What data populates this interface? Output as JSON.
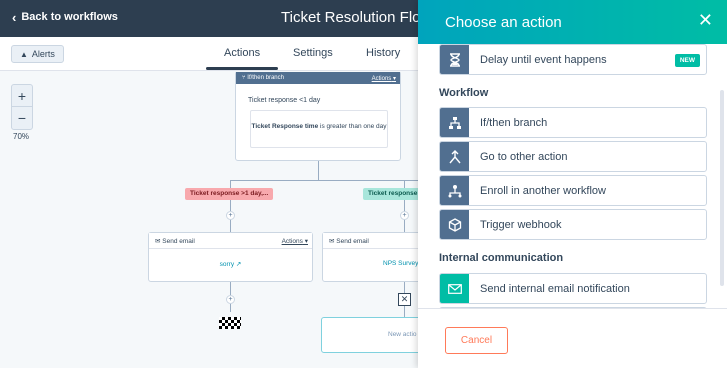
{
  "header": {
    "back_label": "Back to workflows",
    "workflow_title": "Ticket Resolution Flow"
  },
  "tabbar": {
    "alerts_label": "Alerts",
    "tabs": [
      {
        "label": "Actions",
        "active": true
      },
      {
        "label": "Settings",
        "active": false
      },
      {
        "label": "History",
        "active": false
      }
    ]
  },
  "canvas": {
    "zoom_in": "+",
    "zoom_out": "−",
    "zoom_level": "70%",
    "branch_node": {
      "header": "If/then branch",
      "actions_label": "Actions",
      "title": "Ticket response <1 day",
      "condition_prefix": "Ticket Response time",
      "condition_suffix": "is greater than one day"
    },
    "branches": [
      {
        "label": "Ticket response >1 day,...",
        "color": "#f8a9ad"
      },
      {
        "label": "Ticket response",
        "color": "#a8e6db"
      }
    ],
    "email_cards": [
      {
        "header": "Send email",
        "actions_label": "Actions",
        "link": "sorry"
      },
      {
        "header": "Send email",
        "link": "NPS Survey"
      }
    ],
    "new_action_label": "New actio"
  },
  "panel": {
    "title": "Choose an action",
    "top_item": {
      "label": "Delay until event happens",
      "badge": "NEW",
      "icon": "hourglass-icon"
    },
    "sections": [
      {
        "title": "Workflow",
        "items": [
          {
            "label": "If/then branch",
            "icon": "branch-icon"
          },
          {
            "label": "Go to other action",
            "icon": "goto-icon"
          },
          {
            "label": "Enroll in another workflow",
            "icon": "enroll-icon"
          },
          {
            "label": "Trigger webhook",
            "icon": "webhook-icon"
          }
        ]
      },
      {
        "title": "Internal communication",
        "items": [
          {
            "label": "Send internal email notification",
            "icon": "envelope-icon"
          }
        ]
      }
    ],
    "cancel_label": "Cancel"
  },
  "colors": {
    "topbar": "#2d3e50",
    "panel_header_start": "#00a4bd",
    "panel_header_end": "#00bda5",
    "icon_slate": "#516f90",
    "icon_teal": "#00bda5",
    "cancel": "#ff7a59"
  }
}
